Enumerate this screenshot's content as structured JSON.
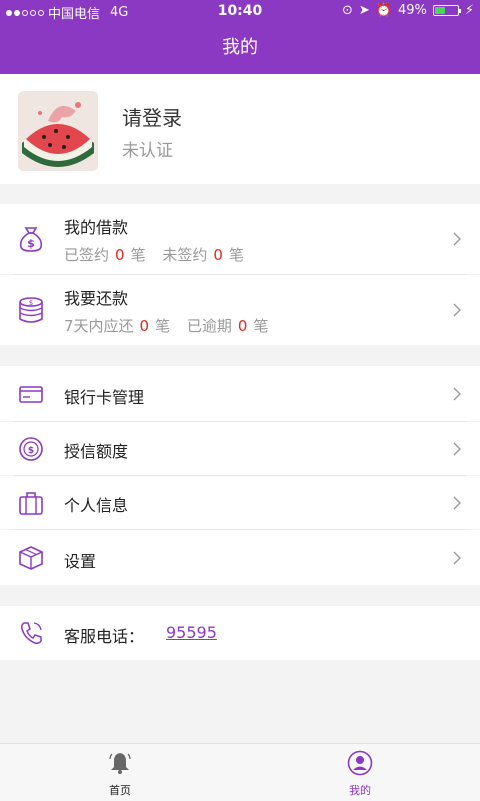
{
  "status": {
    "carrier": "中国电信",
    "network": "4G",
    "time": "10:40",
    "battery": "49%"
  },
  "header": {
    "title": "我的"
  },
  "profile": {
    "name": "请登录",
    "sub": "未认证"
  },
  "loans": {
    "title": "我的借款",
    "signed_label": "已签约",
    "signed_count": "0",
    "unit": "笔",
    "unsigned_label": "未签约",
    "unsigned_count": "0"
  },
  "repay": {
    "title": "我要还款",
    "due_label": "7天内应还",
    "due_count": "0",
    "unit": "笔",
    "overdue_label": "已逾期",
    "overdue_count": "0"
  },
  "menu": [
    {
      "label": "银行卡管理",
      "icon": "bank-card-icon"
    },
    {
      "label": "授信额度",
      "icon": "credit-coin-icon"
    },
    {
      "label": "个人信息",
      "icon": "suitcase-icon"
    },
    {
      "label": "设置",
      "icon": "box-icon"
    }
  ],
  "service": {
    "label": "客服电话：",
    "phone": "95595"
  },
  "tabs": [
    {
      "label": "首页",
      "icon": "bell-icon"
    },
    {
      "label": "我的",
      "icon": "user-icon"
    }
  ],
  "colors": {
    "accent": "#8b38c3",
    "highlight": "#e0291e"
  }
}
